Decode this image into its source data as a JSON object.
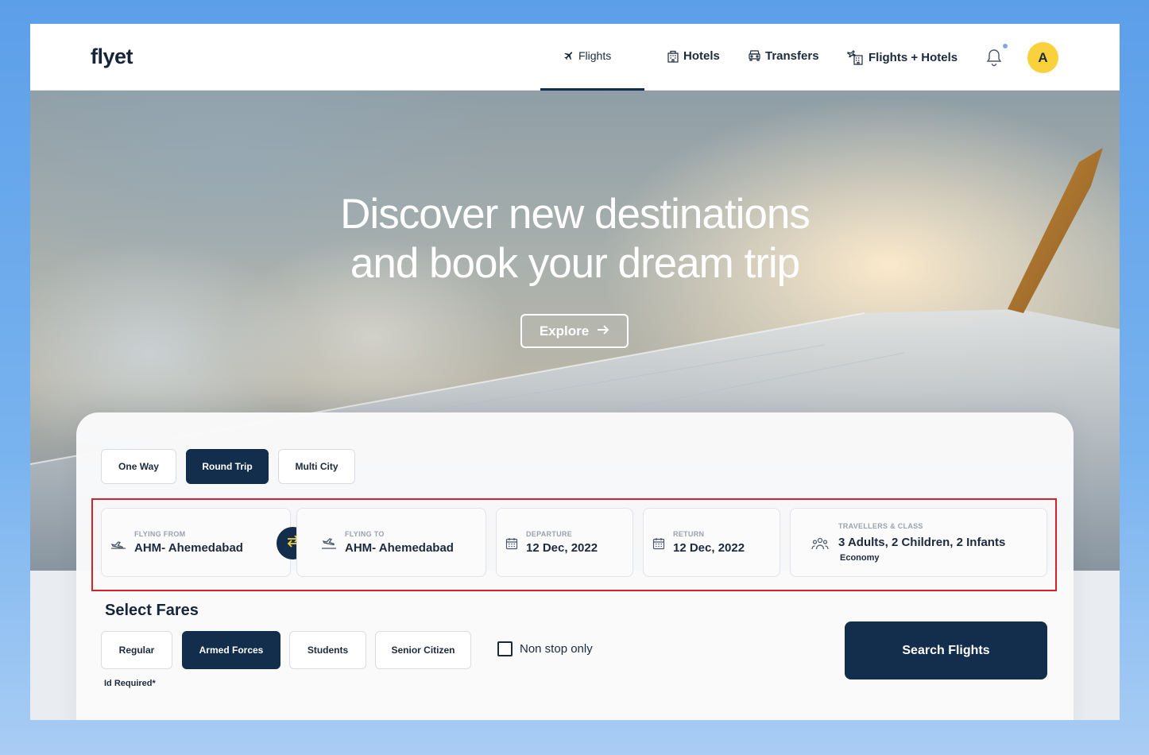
{
  "brand": {
    "logo": "flyet"
  },
  "nav": {
    "items": [
      {
        "label": "Flights",
        "icon": "plane-icon",
        "active": true
      },
      {
        "label": "Hotels",
        "icon": "hotel-icon"
      },
      {
        "label": "Transfers",
        "icon": "car-icon"
      },
      {
        "label": "Flights + Hotels",
        "icon": "flight-hotel-icon"
      }
    ],
    "avatar_initial": "A"
  },
  "hero": {
    "title_line1": "Discover new destinations",
    "title_line2": "and book your dream trip",
    "explore_label": "Explore"
  },
  "trip_types": {
    "options": [
      "One Way",
      "Round Trip",
      "Multi City"
    ],
    "selected": "Round Trip"
  },
  "search": {
    "from": {
      "label": "FLYING FROM",
      "value": "AHM- Ahemedabad"
    },
    "to": {
      "label": "FLYING TO",
      "value": "AHM- Ahemedabad"
    },
    "departure": {
      "label": "DEPARTURE",
      "value": "12 Dec, 2022"
    },
    "return": {
      "label": "RETURN",
      "value": "12 Dec, 2022"
    },
    "travellers": {
      "label": "TRAVELLERS & CLASS",
      "value": "3 Adults, 2 Children, 2 Infants",
      "class": "Economy"
    }
  },
  "fares": {
    "title": "Select Fares",
    "options": [
      "Regular",
      "Armed Forces",
      "Students",
      "Senior Citizen"
    ],
    "selected": "Armed Forces",
    "note": "Id Required*"
  },
  "nonstop": {
    "label": "Non stop only",
    "checked": false
  },
  "search_button": "Search Flights",
  "colors": {
    "primary": "#132d4c",
    "accent": "#f8d13c",
    "highlight": "#d6232a"
  }
}
